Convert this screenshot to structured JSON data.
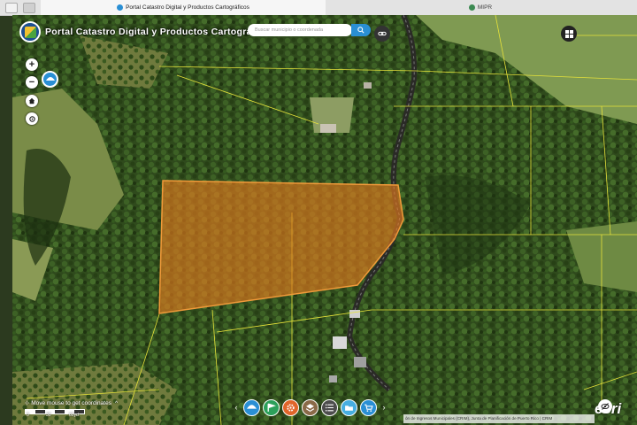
{
  "browser": {
    "tabs": [
      {
        "title": "Portal Catastro Digital y Productos Cartográficos",
        "active": true
      },
      {
        "title": "MIPR",
        "active": false
      }
    ]
  },
  "app": {
    "title": "Portal Catastro Digital y Productos Cartográficos",
    "search_placeholder": "Buscar municipio o coordenada"
  },
  "map": {
    "zoom_in": "+",
    "zoom_out": "−",
    "coordinates_prompt": "Move mouse to get coordinates",
    "scale_labels": [
      "0",
      "30",
      "60yd"
    ],
    "attribution": "ón de Ingresos Municipales (CRIM), Junta de Planificación de Puerto Rico | CRIM",
    "esri_logo": "esri",
    "highlight_color": "#e07a1f",
    "parcel_line_color": "#e6e23a"
  },
  "toolbar": {
    "tools": [
      {
        "name": "parcel-tool",
        "icon": "umbrella-icon",
        "color": "#2a8fd4"
      },
      {
        "name": "flag-tool",
        "icon": "flag-icon",
        "color": "#2ca05a"
      },
      {
        "name": "settings-tool",
        "icon": "gear-icon",
        "color": "#e0652a"
      },
      {
        "name": "layers-tool",
        "icon": "layers-icon",
        "color": "#8a6a48"
      },
      {
        "name": "list-tool",
        "icon": "list-icon",
        "color": "#4d4d4d"
      },
      {
        "name": "folder-tool",
        "icon": "folder-icon",
        "color": "#47aee0"
      },
      {
        "name": "cart-tool",
        "icon": "cart-icon",
        "color": "#2a8fd4"
      }
    ]
  }
}
